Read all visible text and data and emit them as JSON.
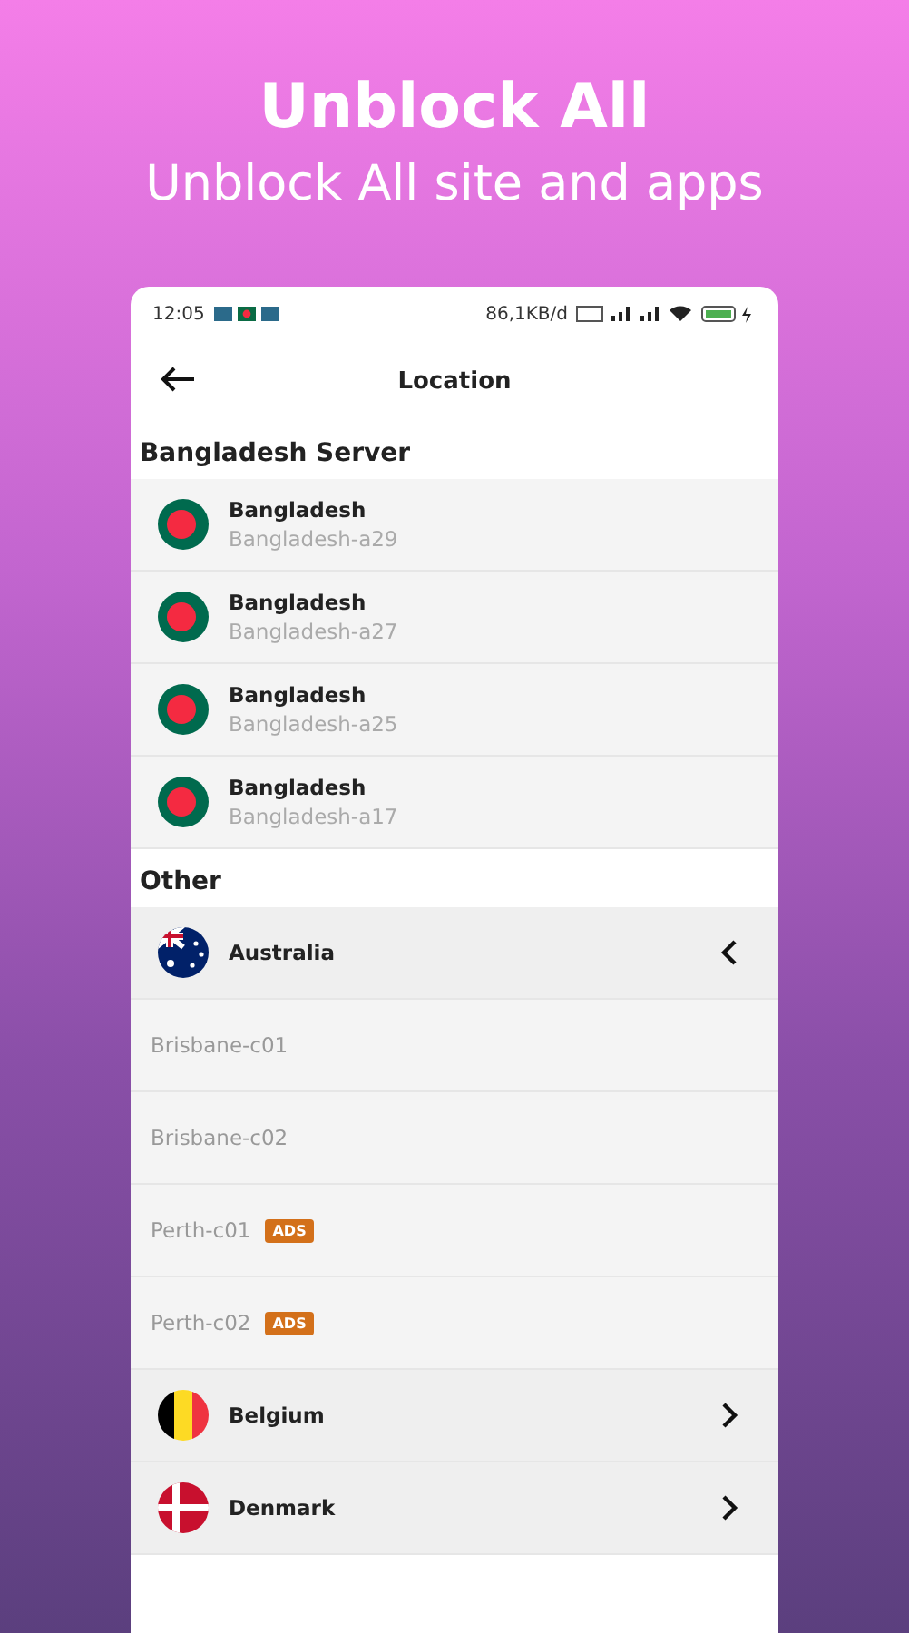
{
  "headline": "Unblock All",
  "subtitle": "Unblock All site and apps",
  "status_bar": {
    "time": "12:05",
    "speed": "86,1KB/d"
  },
  "header": {
    "title": "Location"
  },
  "sections": [
    {
      "title": "Bangladesh Server",
      "kind": "servers",
      "items": [
        {
          "kind": "bangladesh",
          "name": "Bangladesh",
          "server": "Bangladesh-a29"
        },
        {
          "kind": "bangladesh",
          "name": "Bangladesh",
          "server": "Bangladesh-a27"
        },
        {
          "kind": "bangladesh",
          "name": "Bangladesh",
          "server": "Bangladesh-a25"
        },
        {
          "kind": "bangladesh",
          "name": "Bangladesh",
          "server": "Bangladesh-a17"
        }
      ]
    },
    {
      "title": "Other",
      "kind": "countries",
      "items": [
        {
          "kind": "australia",
          "name": "Australia",
          "expanded": true,
          "children": [
            {
              "name": "Brisbane-c01"
            },
            {
              "name": "Brisbane-c02"
            },
            {
              "name": "Perth-c01",
              "badge": "ADS"
            },
            {
              "name": "Perth-c02",
              "badge": "ADS"
            }
          ]
        },
        {
          "kind": "belgium",
          "name": "Belgium",
          "expanded": false
        },
        {
          "kind": "denmark",
          "name": "Denmark",
          "expanded": false
        }
      ]
    }
  ]
}
